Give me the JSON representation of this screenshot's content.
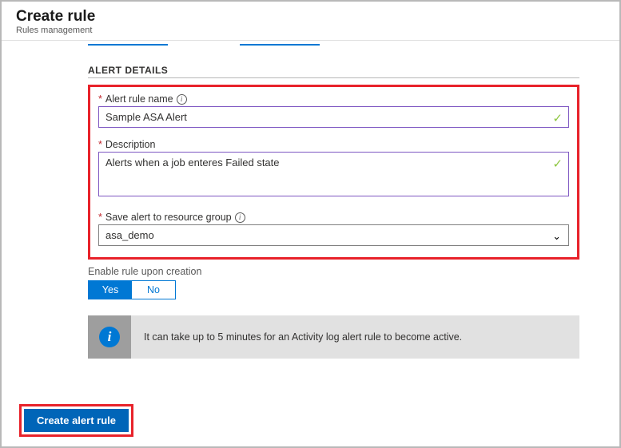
{
  "header": {
    "title": "Create rule",
    "subtitle": "Rules management"
  },
  "section": {
    "title": "ALERT DETAILS"
  },
  "fields": {
    "name": {
      "label": "Alert rule name",
      "value": "Sample ASA Alert",
      "required": "*"
    },
    "description": {
      "label": "Description",
      "value": "Alerts when a job enteres Failed state",
      "required": "*"
    },
    "resourceGroup": {
      "label": "Save alert to resource group",
      "value": "asa_demo",
      "required": "*"
    }
  },
  "toggle": {
    "label": "Enable rule upon creation",
    "yes": "Yes",
    "no": "No"
  },
  "note": {
    "text": "It can take up to 5 minutes for an Activity log alert rule to become active."
  },
  "footer": {
    "create": "Create alert rule"
  }
}
